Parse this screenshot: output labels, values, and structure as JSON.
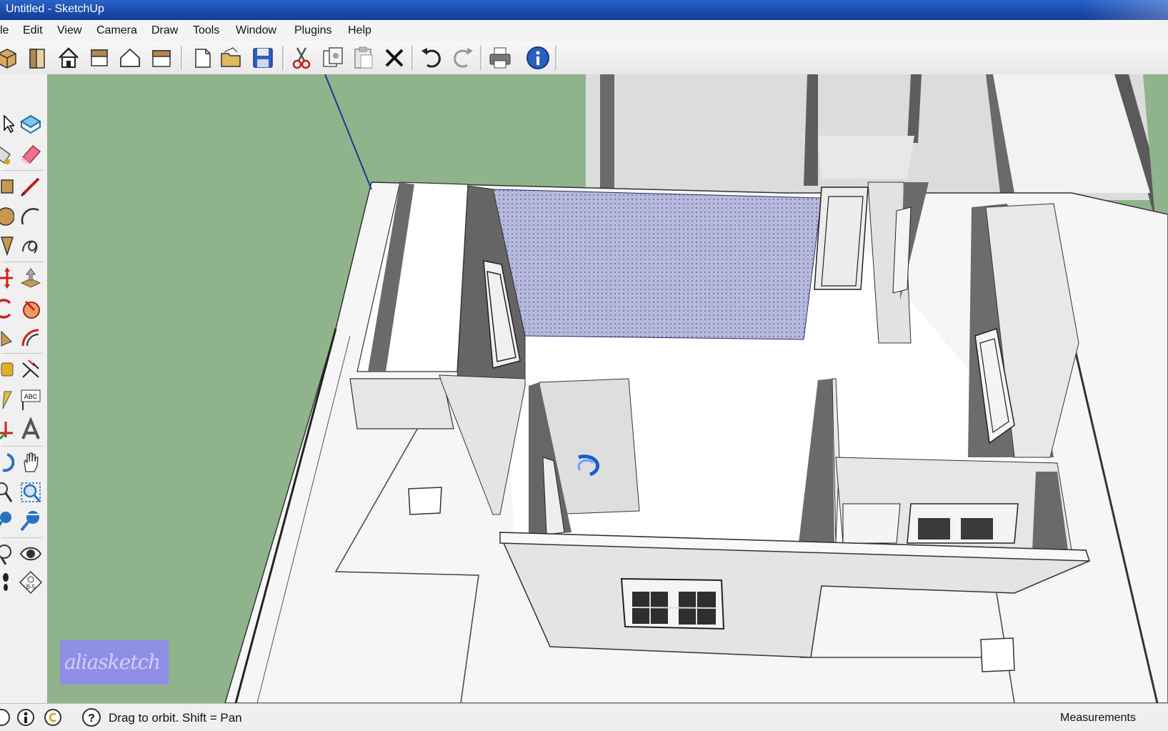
{
  "window": {
    "title": "Untitled - SketchUp"
  },
  "menu": {
    "items": [
      "le",
      "Edit",
      "View",
      "Camera",
      "Draw",
      "Tools",
      "Window",
      "Plugins",
      "Help"
    ]
  },
  "toolbar": {
    "icons": [
      "views-iso-icon",
      "views-left-icon",
      "views-home-icon",
      "views-front-icon",
      "views-back-icon",
      "views-right-icon",
      "new-icon",
      "open-icon",
      "save-icon",
      "cut-icon",
      "copy-icon",
      "paste-icon",
      "erase-icon",
      "undo-icon",
      "redo-icon",
      "print-icon",
      "model-info-icon"
    ]
  },
  "left_toolbar": {
    "icons": [
      "select-icon",
      "make-component-icon",
      "paint-bucket-icon",
      "eraser-icon",
      "rectangle-icon",
      "line-icon",
      "circle-icon",
      "arc-icon",
      "polygon-icon",
      "freehand-icon",
      "move-icon",
      "push-pull-icon",
      "rotate-icon",
      "follow-me-icon",
      "scale-icon",
      "offset-icon",
      "tape-measure-icon",
      "dimension-icon",
      "protractor-icon",
      "text-icon",
      "axes-icon",
      "3d-text-icon",
      "orbit-icon",
      "pan-icon",
      "zoom-icon",
      "zoom-window-icon",
      "zoom-extents-icon",
      "previous-view-icon",
      "position-camera-icon",
      "look-around-icon",
      "walk-icon",
      "section-plane-icon"
    ]
  },
  "viewport": {
    "watermark": "aliasketch",
    "cursor": "orbit-cursor-icon"
  },
  "status": {
    "hint": "Drag to orbit.  Shift = Pan",
    "measurements_label": "Measurements"
  },
  "colors": {
    "ground": "#8fb38a",
    "wall_face": "#e4e4e4",
    "wall_shadow": "#6c6c6c",
    "selected_face": "#b0b4d8",
    "title_bar": "#1a4aa8"
  }
}
